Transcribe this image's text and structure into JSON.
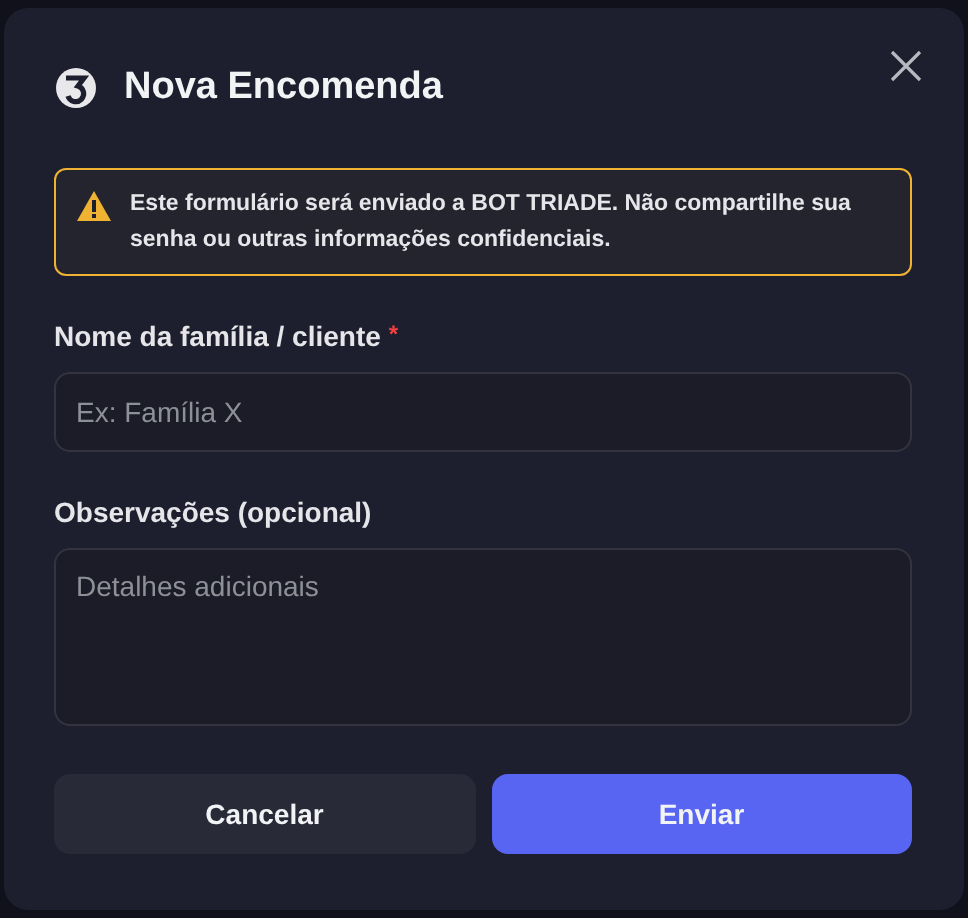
{
  "dialog": {
    "title": "Nova Encomenda",
    "warning": "Este formulário será enviado a BOT TRIADE. Não compartilhe sua senha ou outras informações confidenciais.",
    "fields": [
      {
        "kind": "input",
        "label": "Nome da família / cliente",
        "required_mark": "*",
        "placeholder": "Ex: Família X"
      },
      {
        "kind": "textarea",
        "label": "Observações (opcional)",
        "placeholder": "Detalhes adicionais"
      }
    ],
    "buttons": [
      {
        "label": "Cancelar",
        "kind": "secondary"
      },
      {
        "label": "Enviar",
        "kind": "primary"
      }
    ]
  }
}
